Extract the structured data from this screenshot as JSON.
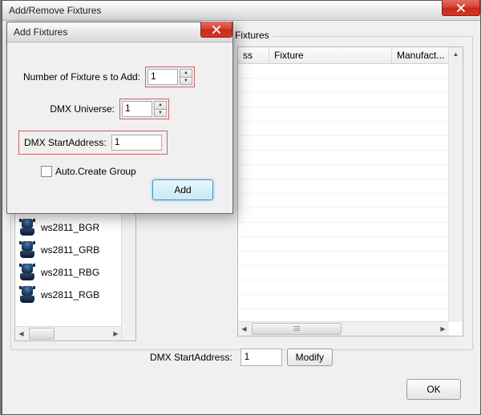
{
  "main_window": {
    "title": "Add/Remove Fixtures",
    "fixtures_group_label": "Fixtures",
    "table": {
      "columns": [
        "ss",
        "Fixture",
        "Manufact..."
      ]
    },
    "fixture_list": [
      "ws2811_BGR",
      "ws2811_GRB",
      "ws2811_RBG",
      "ws2811_RGB"
    ],
    "bottom": {
      "label": "DMX StartAddress:",
      "value": "1",
      "modify_label": "Modify"
    },
    "ok_label": "OK"
  },
  "modal": {
    "title": "Add Fixtures",
    "num_fixtures_label": "Number of Fixture s to Add:",
    "num_fixtures_value": "1",
    "dmx_universe_label": "DMX Universe:",
    "dmx_universe_value": "1",
    "dmx_start_label": "DMX StartAddress:",
    "dmx_start_value": "1",
    "auto_create_label": "Auto.Create Group",
    "add_label": "Add"
  }
}
